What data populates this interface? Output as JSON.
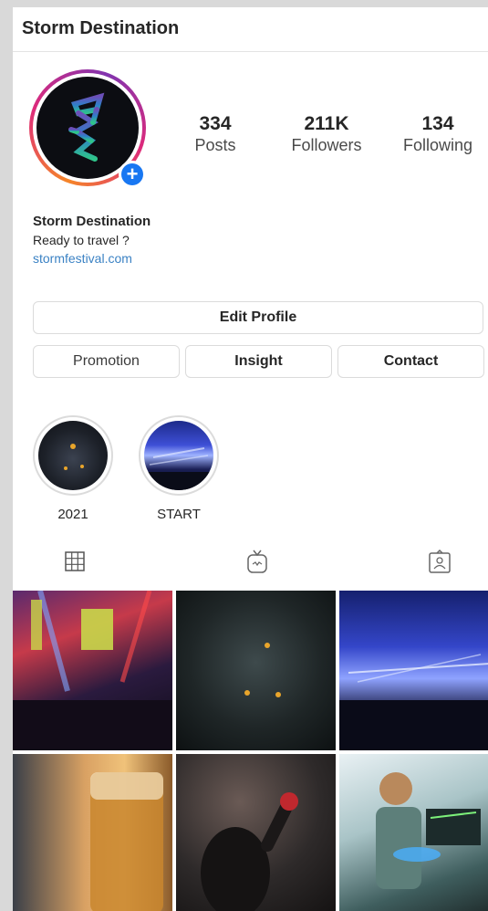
{
  "header": {
    "title": "Storm Destination"
  },
  "profile": {
    "avatar_icon": "storm-logo-icon",
    "add_story_icon": "plus-icon",
    "add_story_symbol": "+",
    "stats": [
      {
        "value": "334",
        "label": "Posts"
      },
      {
        "value": "211K",
        "label": "Followers"
      },
      {
        "value": "134",
        "label": "Following"
      }
    ],
    "name": "Storm Destination",
    "bio": "Ready to travel ?",
    "website": "stormfestival.com"
  },
  "actions": {
    "edit_profile": "Edit Profile",
    "promotion": "Promotion",
    "insight": "Insight",
    "contact": "Contact"
  },
  "highlights": [
    {
      "label": "2021"
    },
    {
      "label": "START"
    }
  ],
  "tabs": [
    {
      "icon": "grid-icon",
      "active": true
    },
    {
      "icon": "igtv-icon",
      "active": false
    },
    {
      "icon": "tagged-icon",
      "active": false
    }
  ],
  "colors": {
    "link": "#3b82c4",
    "badge": "#1877f2",
    "ring_start": "#f58529",
    "ring_end": "#8134af"
  }
}
